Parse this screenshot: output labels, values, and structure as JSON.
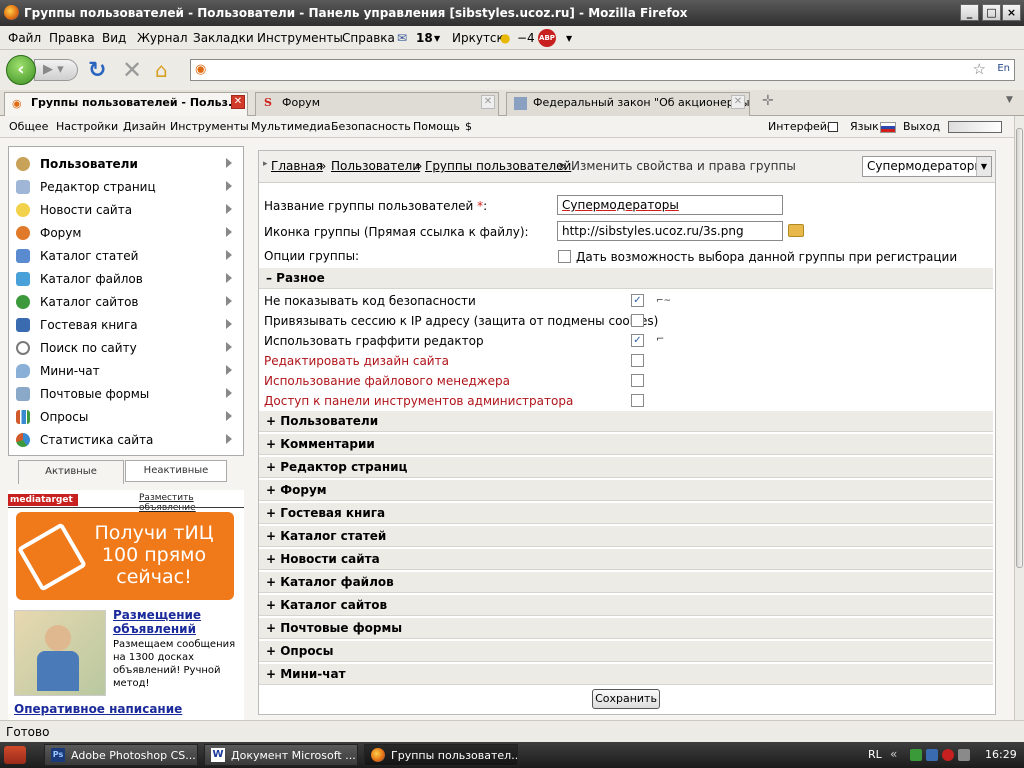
{
  "window": {
    "title": "Группы пользователей - Пользователи - Панель управления [sibstyles.ucoz.ru] - Mozilla Firefox"
  },
  "menu": [
    "Файл",
    "Правка",
    "Вид",
    "Журнал",
    "Закладки",
    "Инструменты",
    "Справка"
  ],
  "toolbar_extras": {
    "mail_count": "18",
    "city": "Иркутск",
    "temp": "−4",
    "abp": "ABP"
  },
  "tabs": [
    {
      "label": "Группы пользователей - Польз..."
    },
    {
      "label": "Форум"
    },
    {
      "label": "Федеральный закон \"Об акционерны..."
    }
  ],
  "panel_menu": {
    "items": [
      "Общее",
      "Настройки",
      "Дизайн",
      "Инструменты",
      "Мультимедиа",
      "Безопасность",
      "Помощь",
      "$"
    ],
    "right": {
      "interface": "Интерфейс",
      "language": "Язык",
      "logout": "Выход"
    }
  },
  "sidebar": {
    "items": [
      {
        "label": "Пользователи",
        "icon": "user-icon",
        "color": "#c9a25a"
      },
      {
        "label": "Редактор страниц",
        "icon": "page-icon",
        "color": "#9fb6d6"
      },
      {
        "label": "Новости сайта",
        "icon": "bulb-icon",
        "color": "#f2d24a"
      },
      {
        "label": "Форум",
        "icon": "forum-icon",
        "color": "#e07a2a"
      },
      {
        "label": "Каталог статей",
        "icon": "articles-icon",
        "color": "#5a8ad0"
      },
      {
        "label": "Каталог файлов",
        "icon": "files-icon",
        "color": "#4aa0d8"
      },
      {
        "label": "Каталог сайтов",
        "icon": "globe-icon",
        "color": "#3c9a3c"
      },
      {
        "label": "Гостевая книга",
        "icon": "book-icon",
        "color": "#3a6ab0"
      },
      {
        "label": "Поиск по сайту",
        "icon": "search-icon",
        "color": "#7a7a7a"
      },
      {
        "label": "Мини-чат",
        "icon": "chat-icon",
        "color": "#8ab0d8"
      },
      {
        "label": "Почтовые формы",
        "icon": "mail-icon",
        "color": "#8aa8c8"
      },
      {
        "label": "Опросы",
        "icon": "poll-icon",
        "color": "#d05a2a"
      },
      {
        "label": "Статистика сайта",
        "icon": "chart-icon",
        "color": "#3a8ad0"
      }
    ],
    "tabs": [
      "Активные",
      "Неактивные"
    ]
  },
  "ad": {
    "brand": "mediatarget",
    "place_link": "Разместить объявление",
    "banner": "Получи тИЦ 100 прямо сейчас!",
    "item1_title": "Размещение объявлений",
    "item1_text": "Размещаем сообщения на 1300 досках объявлений! Ручной метод!",
    "item2_title": "Оперативное написание"
  },
  "breadcrumb": {
    "links": [
      "Главная",
      "Пользователи",
      "Группы пользователей"
    ],
    "current": "Изменить свойства и права группы",
    "select": "Супермодераторы"
  },
  "form": {
    "name_label": "Название группы пользователей",
    "required": "*",
    "name_value": "Супермодераторы",
    "icon_label": "Иконка группы (Прямая ссылка к файлу):",
    "icon_value": "http://sibstyles.ucoz.ru/3s.png",
    "options_label": "Опции группы:",
    "options_checkbox": "Дать возможность выбора данной группы при регистрации"
  },
  "misc_section": {
    "title": "– Разное",
    "permissions": [
      {
        "label": "Не показывать код безопасности",
        "checked": true,
        "red": false
      },
      {
        "label": "Привязывать сессию к IP адресу (защита от подмены cookies)",
        "checked": false,
        "red": false
      },
      {
        "label": "Использовать граффити редактор",
        "checked": true,
        "red": false
      },
      {
        "label": "Редактировать дизайн сайта",
        "checked": false,
        "red": true
      },
      {
        "label": "Использование файлового менеджера",
        "checked": false,
        "red": true
      },
      {
        "label": "Доступ к панели инструментов администратора",
        "checked": false,
        "red": true
      }
    ]
  },
  "sections": [
    "+ Пользователи",
    "+ Комментарии",
    "+ Редактор страниц",
    "+ Форум",
    "+ Гостевая книга",
    "+ Каталог статей",
    "+ Новости сайта",
    "+ Каталог файлов",
    "+ Каталог сайтов",
    "+ Почтовые формы",
    "+ Опросы",
    "+ Мини-чат"
  ],
  "save_label": "Сохранить",
  "status": "Готово",
  "taskbar": {
    "items": [
      "Adobe Photoshop CS...",
      "Документ Microsoft ...",
      "Группы пользовател..."
    ],
    "lang": "RL",
    "clock": "16:29"
  }
}
